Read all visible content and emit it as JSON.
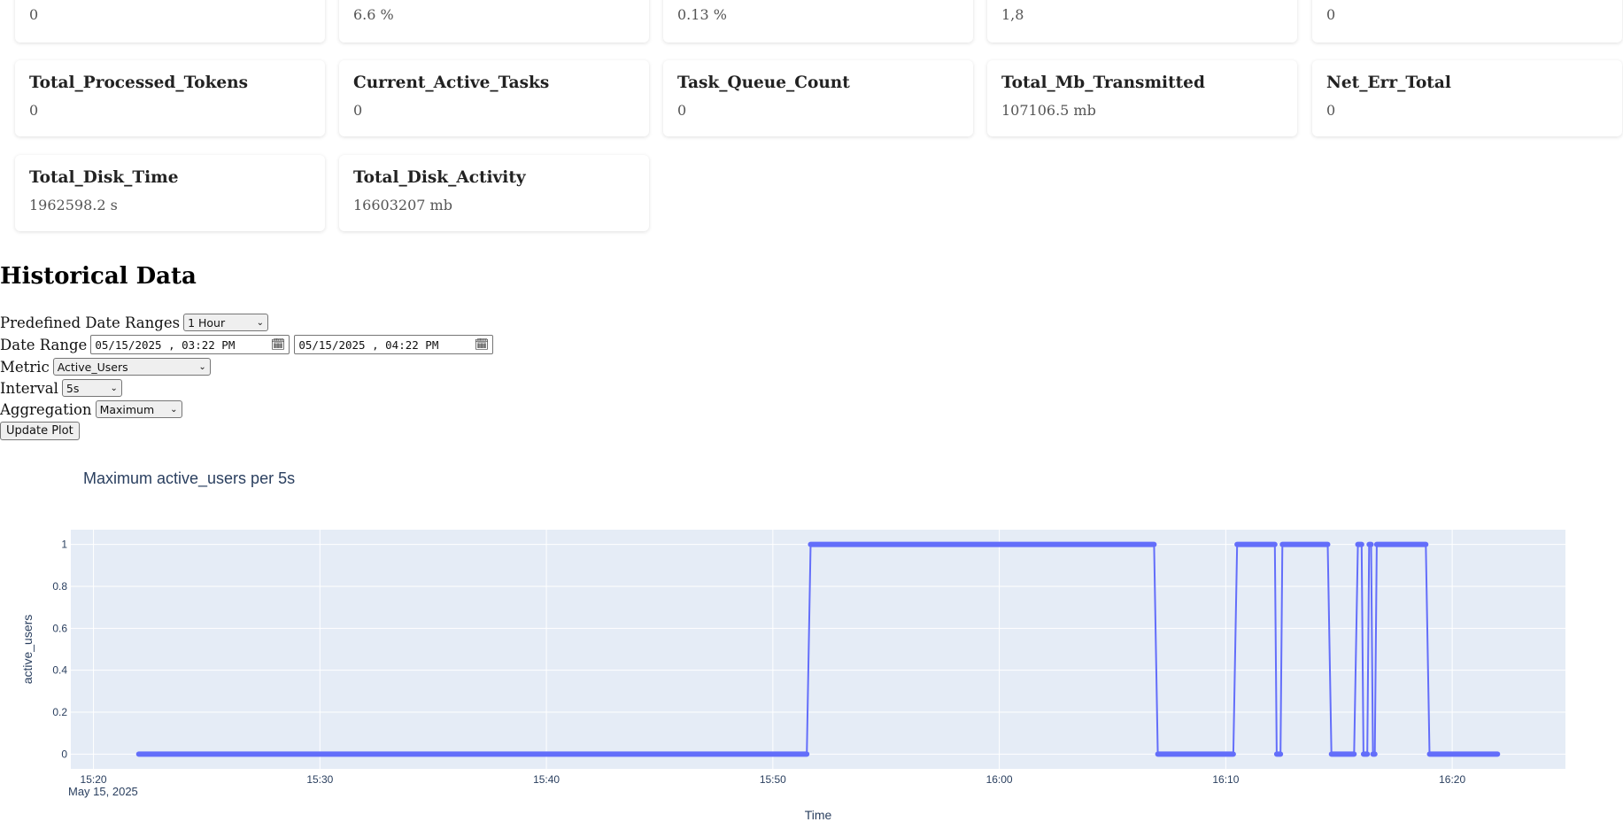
{
  "cards": [
    {
      "title": "",
      "value": "0"
    },
    {
      "title": "",
      "value": "6.6 %"
    },
    {
      "title": "",
      "value": "0.13 %"
    },
    {
      "title": "",
      "value": "1,8"
    },
    {
      "title": "",
      "value": "0"
    },
    {
      "title": "Total_Processed_Tokens",
      "value": "0"
    },
    {
      "title": "Current_Active_Tasks",
      "value": "0"
    },
    {
      "title": "Task_Queue_Count",
      "value": "0"
    },
    {
      "title": "Total_Mb_Transmitted",
      "value": "107106.5 mb"
    },
    {
      "title": "Net_Err_Total",
      "value": "0"
    },
    {
      "title": "Total_Disk_Time",
      "value": "1962598.2 s"
    },
    {
      "title": "Total_Disk_Activity",
      "value": "16603207 mb"
    }
  ],
  "historical": {
    "heading": "Historical Data",
    "predefined_label": "Predefined Date Ranges",
    "predefined_value": "1 Hour",
    "date_range_label": "Date Range",
    "date_start": "05/15/2025 , 03:22  PM",
    "date_end": "05/15/2025 , 04:22  PM",
    "metric_label": "Metric",
    "metric_value": "Active_Users",
    "interval_label": "Interval",
    "interval_value": "5s",
    "aggregation_label": "Aggregation",
    "aggregation_value": "Maximum",
    "update_button": "Update Plot"
  },
  "icons": {
    "dropdown": "chevron-down-icon",
    "calendar": "calendar-icon"
  },
  "colors": {
    "line": "#636efa",
    "plot_bg": "#e5ecf6",
    "title": "#2a3f5f"
  },
  "chart_data": {
    "type": "line",
    "title": "Maximum active_users per 5s",
    "xlabel": "Time",
    "ylabel": "active_users",
    "x_ticks": [
      "15:20",
      "15:30",
      "15:40",
      "15:50",
      "16:00",
      "16:10",
      "16:20"
    ],
    "x_date_label": "May 15, 2025",
    "y_ticks": [
      "0",
      "0.2",
      "0.4",
      "0.6",
      "0.8",
      "1"
    ],
    "xlim": [
      "15:19",
      "16:25"
    ],
    "ylim": [
      -0.07,
      1.07
    ],
    "grid": true,
    "segments": [
      {
        "start": "15:22:00",
        "end": "15:51:30",
        "value": 0
      },
      {
        "start": "15:51:40",
        "end": "16:06:50",
        "value": 1
      },
      {
        "start": "16:07:00",
        "end": "16:10:20",
        "value": 0
      },
      {
        "start": "16:10:30",
        "end": "16:12:10",
        "value": 1
      },
      {
        "start": "16:12:15",
        "end": "16:12:25",
        "value": 0
      },
      {
        "start": "16:12:30",
        "end": "16:14:30",
        "value": 1
      },
      {
        "start": "16:14:40",
        "end": "16:15:40",
        "value": 0
      },
      {
        "start": "16:15:50",
        "end": "16:16:00",
        "value": 1
      },
      {
        "start": "16:16:05",
        "end": "16:16:15",
        "value": 0
      },
      {
        "start": "16:16:20",
        "end": "16:16:25",
        "value": 1
      },
      {
        "start": "16:16:30",
        "end": "16:16:35",
        "value": 0
      },
      {
        "start": "16:16:40",
        "end": "16:18:50",
        "value": 1
      },
      {
        "start": "16:19:00",
        "end": "16:22:00",
        "value": 0
      }
    ]
  }
}
